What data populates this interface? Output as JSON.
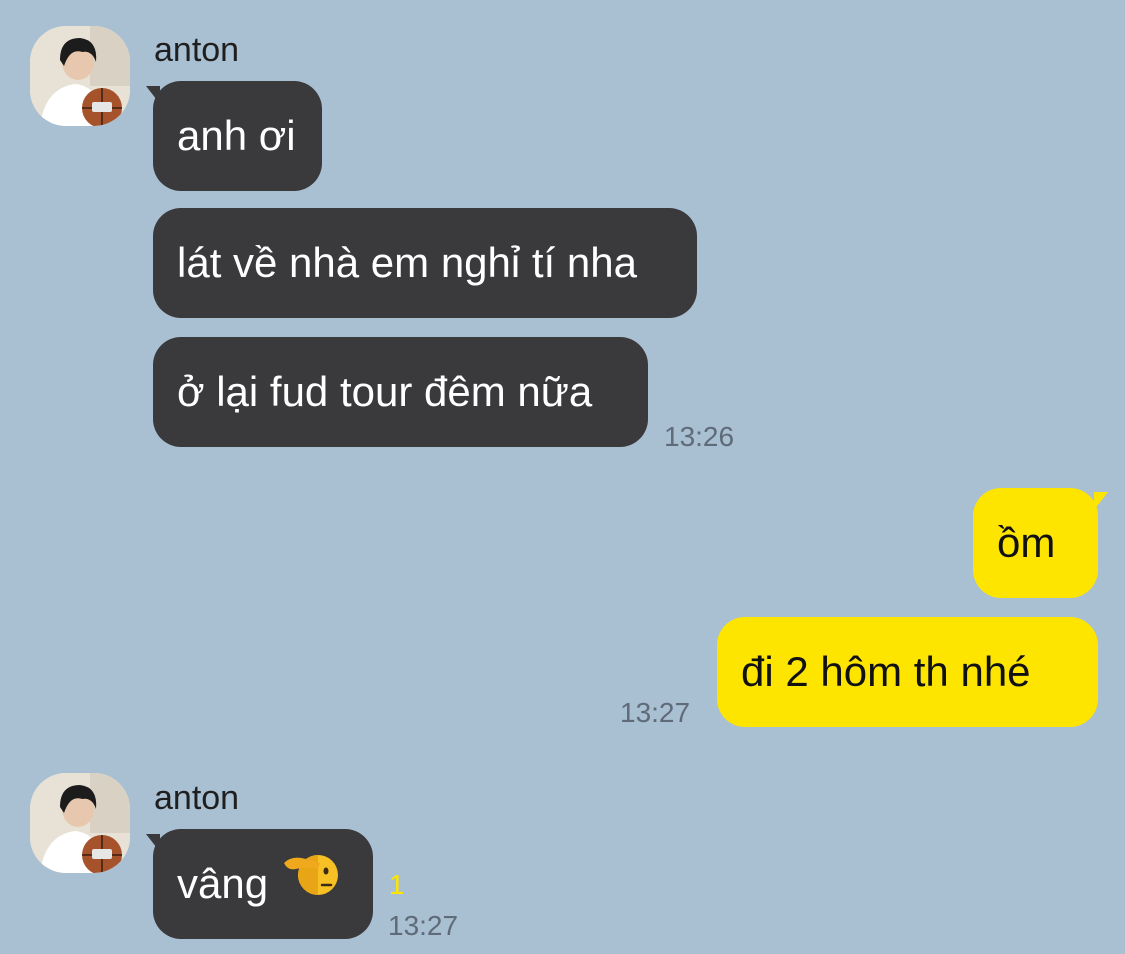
{
  "conversation": {
    "groups": [
      {
        "sender": "anton",
        "messages": [
          "anh ơi",
          "lát về nhà em nghỉ tí nha",
          "ở lại fud tour đêm nữa"
        ],
        "time": "13:26"
      },
      {
        "sender": "me",
        "messages": [
          "ồm",
          "đi 2 hôm th nhé"
        ],
        "time": "13:27"
      },
      {
        "sender": "anton",
        "messages": [
          {
            "text": "vâng",
            "emoji": "saluting-face-icon"
          }
        ],
        "unread_count": "1",
        "time": "13:27"
      }
    ]
  },
  "colors": {
    "background": "#a9bfd2",
    "incoming_bubble": "#3a3a3c",
    "outgoing_bubble": "#fee500",
    "timestamp": "#5f6b78",
    "unread_badge": "#fee500"
  }
}
